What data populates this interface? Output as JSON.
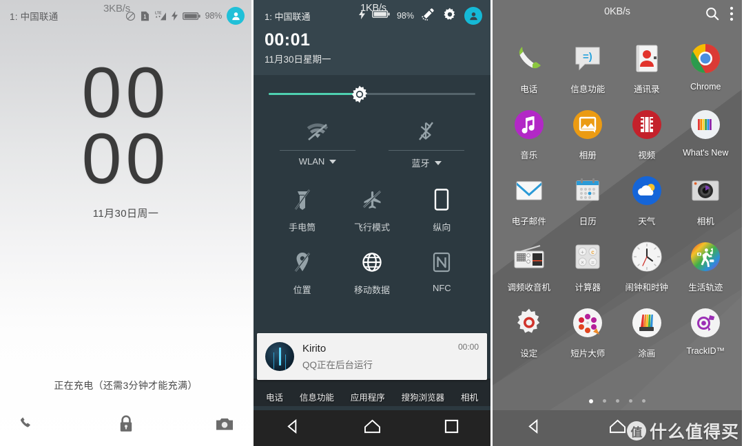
{
  "lockscreen": {
    "status": {
      "carrier": "1: 中国联通",
      "network_speed": "3KB/s",
      "battery_percent": "98%",
      "icons": [
        "no-disturb-icon",
        "sim1-icon",
        "lte-signal-icon",
        "charging-bolt-icon",
        "battery-icon",
        "user-avatar-icon"
      ]
    },
    "clock": {
      "line1": "00",
      "line2": "00"
    },
    "date": "11月30日周一",
    "charging_text": "正在充电（还需3分钟才能充满）",
    "shortcuts": [
      {
        "name": "phone-shortcut",
        "icon": "phone-icon"
      },
      {
        "name": "lock-indicator",
        "icon": "lock-icon"
      },
      {
        "name": "camera-shortcut",
        "icon": "camera-icon"
      }
    ]
  },
  "quicksettings": {
    "status": {
      "carrier": "1: 中国联通",
      "network_speed": "1KB/s",
      "battery_percent": "98%",
      "edit_icon": "pencil-edit-icon",
      "settings_icon": "gear-icon",
      "user_icon": "user-avatar-icon"
    },
    "time": "00:01",
    "date": "11月30日星期一",
    "brightness": {
      "label": "brightness-slider",
      "value_percent": 44
    },
    "pair_toggles": [
      {
        "label": "WLAN",
        "icon": "wifi-off-icon",
        "has_caret": true
      },
      {
        "label": "蓝牙",
        "icon": "bluetooth-off-icon",
        "has_caret": true
      }
    ],
    "tiles": [
      {
        "label": "手电筒",
        "icon": "flashlight-off-icon"
      },
      {
        "label": "飞行模式",
        "icon": "airplane-off-icon"
      },
      {
        "label": "纵向",
        "icon": "portrait-icon"
      },
      {
        "label": "位置",
        "icon": "location-off-icon"
      },
      {
        "label": "移动数据",
        "icon": "mobile-data-icon"
      },
      {
        "label": "NFC",
        "icon": "nfc-icon"
      }
    ],
    "notification": {
      "title": "Kirito",
      "subtitle": "QQ正在后台运行",
      "time": "00:00",
      "avatar": "kirito-avatar"
    },
    "dock_labels": [
      "电话",
      "信息功能",
      "应用程序",
      "搜狗浏览器",
      "相机"
    ],
    "navbar": [
      "back-icon",
      "home-icon",
      "recents-icon"
    ]
  },
  "appdrawer": {
    "status": {
      "network_speed": "0KB/s",
      "search_icon": "search-icon",
      "overflow_icon": "more-vertical-icon"
    },
    "apps": [
      {
        "label": "电话",
        "icon": "phone-icon"
      },
      {
        "label": "信息功能",
        "icon": "messaging-icon"
      },
      {
        "label": "通讯录",
        "icon": "contacts-icon"
      },
      {
        "label": "Chrome",
        "icon": "chrome-icon"
      },
      {
        "label": "音乐",
        "icon": "music-icon"
      },
      {
        "label": "相册",
        "icon": "album-icon"
      },
      {
        "label": "视频",
        "icon": "video-icon"
      },
      {
        "label": "What's New",
        "icon": "whats-new-icon"
      },
      {
        "label": "电子邮件",
        "icon": "email-icon"
      },
      {
        "label": "日历",
        "icon": "calendar-icon"
      },
      {
        "label": "天气",
        "icon": "weather-icon"
      },
      {
        "label": "相机",
        "icon": "camera-icon"
      },
      {
        "label": "调频收音机",
        "icon": "fm-radio-icon"
      },
      {
        "label": "计算器",
        "icon": "calculator-icon"
      },
      {
        "label": "闹钟和时钟",
        "icon": "clock-icon"
      },
      {
        "label": "生活轨迹",
        "icon": "lifelog-icon"
      },
      {
        "label": "设定",
        "icon": "settings-icon"
      },
      {
        "label": "短片大师",
        "icon": "movie-creator-icon"
      },
      {
        "label": "涂画",
        "icon": "sketch-icon"
      },
      {
        "label": "TrackID™",
        "icon": "trackid-icon"
      }
    ],
    "page_dots": {
      "count": 5,
      "active_index": 0
    },
    "navbar": [
      "back-icon",
      "home-icon"
    ],
    "watermark": {
      "badge": "值",
      "text": "什么值得买"
    }
  },
  "colors": {
    "qs_panel_bg": "#2c3940",
    "qs_header_bg": "#36454d",
    "accent_teal": "#4fd1b0",
    "avatar_cyan": "#15b9d6",
    "drawer_bg": "#6e6e6e"
  }
}
